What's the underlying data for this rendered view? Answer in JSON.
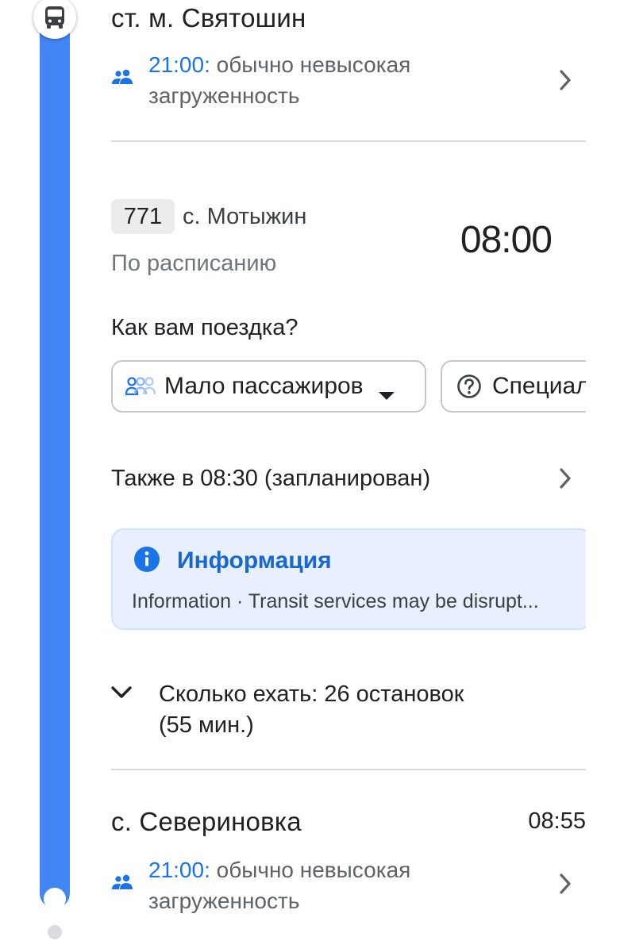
{
  "origin_stop": {
    "name": "ст. м. Святошин",
    "crowd_time": "21:00:",
    "crowd_text": " обычно невысокая загруженность"
  },
  "departure": {
    "route_number": "771",
    "destination": "с. Мотыжин",
    "status": "По расписанию",
    "time": "08:00"
  },
  "feedback": {
    "question": "Как вам поездка?",
    "crowd_chip": "Мало пассажиров",
    "special_chip": "Специал"
  },
  "also_at": {
    "prefix": "Также в ",
    "time": "08:30",
    "suffix": " (запланирован)"
  },
  "info": {
    "title": "Информация",
    "body": "Information · Transit services may be disrupt..."
  },
  "ride": {
    "text": "Сколько ехать: 26 остановок",
    "duration": "(55 мин.)"
  },
  "dest_stop": {
    "name": "с. Севериновка",
    "time": "08:55",
    "crowd_time": "21:00:",
    "crowd_text": " обычно невысокая загруженность"
  },
  "colors": {
    "route": "#4285f4",
    "accent": "#1a73e8",
    "info_bg": "#e8f0fe"
  },
  "icons": [
    "bus-icon",
    "people-icon",
    "chevron-right-icon",
    "chevron-down-icon",
    "caret-down-icon",
    "help-circle-icon",
    "info-icon",
    "crowd-level-icon"
  ]
}
